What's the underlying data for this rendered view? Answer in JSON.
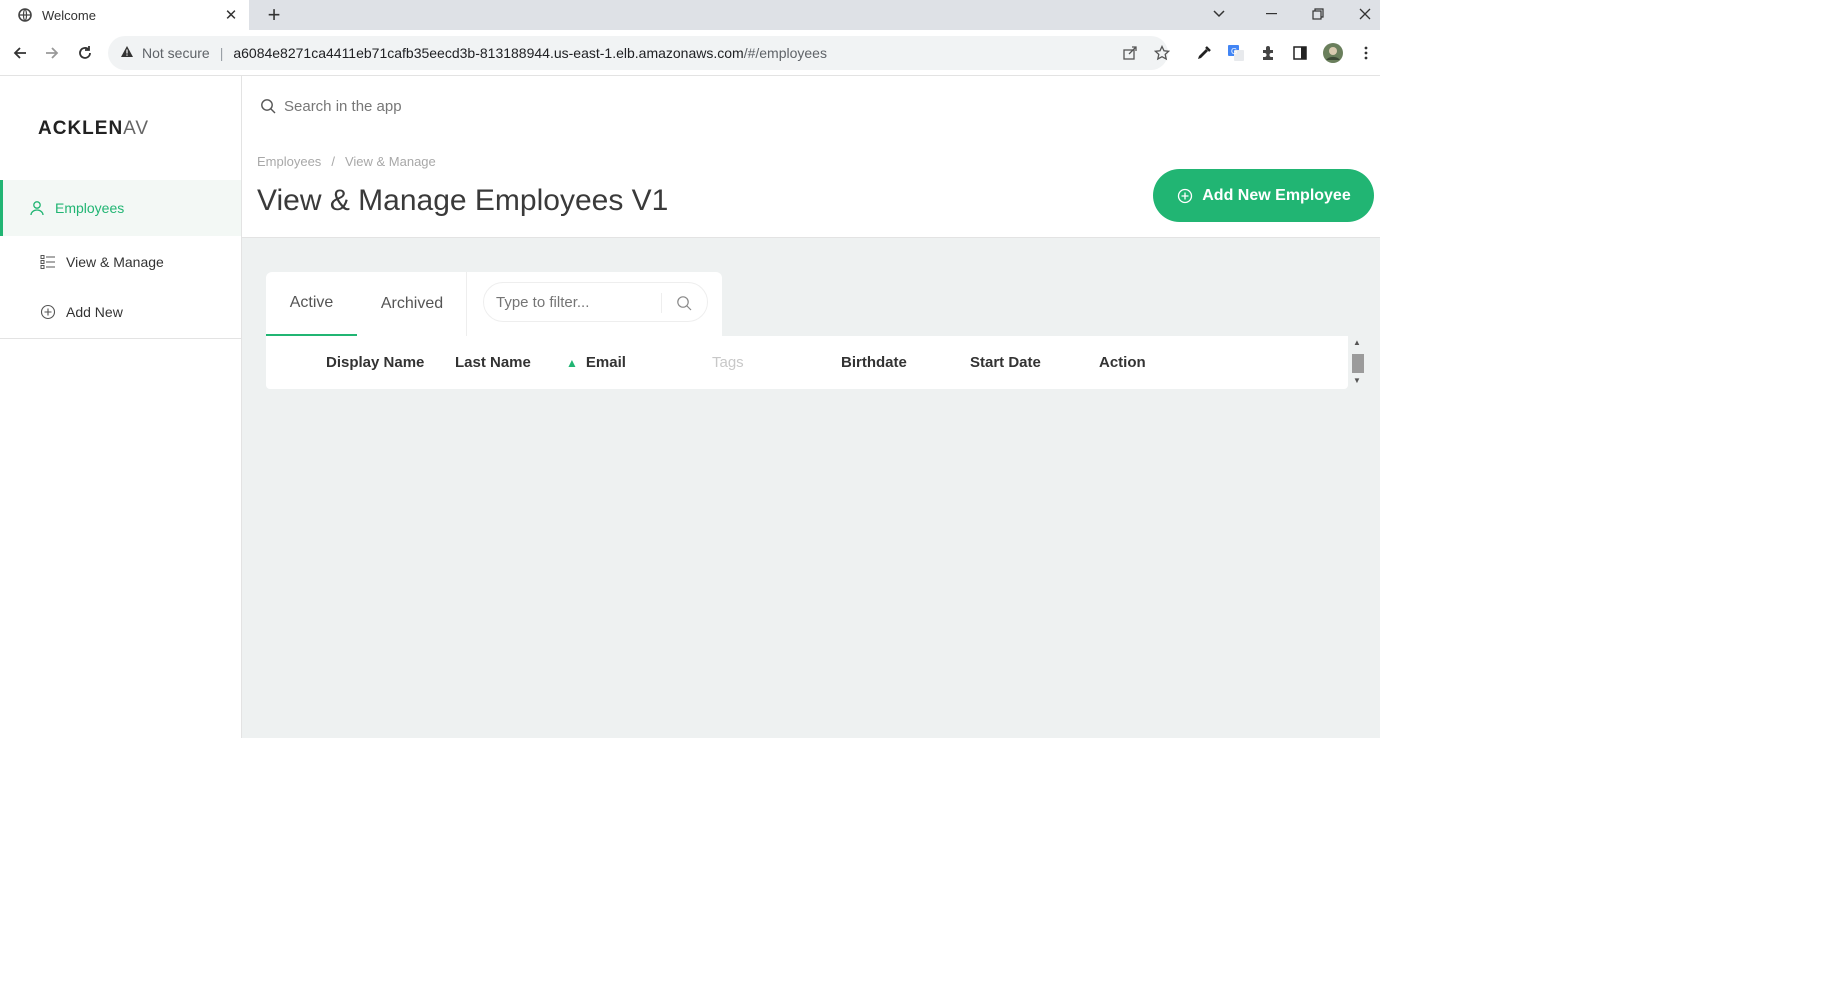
{
  "browser": {
    "tab_title": "Welcome",
    "tab_close": "✕",
    "new_tab": "+",
    "security_label": "Not secure",
    "url_host": "a6084e8271ca4411eb71cafb35eecd3b-813188944.us-east-1.elb.amazonaws.com",
    "url_path": "/#/employees",
    "icons": [
      "globe-icon",
      "back-icon",
      "forward-icon",
      "reload-icon",
      "warning-icon",
      "share-icon",
      "star-icon",
      "eyedropper-icon",
      "translate-icon",
      "extensions-icon",
      "sidepanel-icon",
      "profile-avatar",
      "menu-icon"
    ]
  },
  "app": {
    "logo_bold": "ACKLEN",
    "logo_light": "AV",
    "search_placeholder": "Search in the app",
    "sidebar": {
      "items": [
        {
          "label": "Employees",
          "icon": "user-icon",
          "active": true
        },
        {
          "label": "View & Manage",
          "icon": "list-icon",
          "active": false
        },
        {
          "label": "Add New",
          "icon": "plus-circle-icon",
          "active": false
        }
      ]
    },
    "breadcrumb": [
      "Employees",
      "View & Manage"
    ],
    "breadcrumb_sep": "/",
    "page_title": "View & Manage Employees V1",
    "add_button_label": "Add New Employee",
    "tabs": [
      "Active",
      "Archived"
    ],
    "filter_placeholder": "Type to filter...",
    "columns": [
      "Display Name",
      "Last Name",
      "Email",
      "Tags",
      "Birthdate",
      "Start Date",
      "Action"
    ],
    "sorted_column": "Email",
    "accent_color": "#21b573"
  }
}
